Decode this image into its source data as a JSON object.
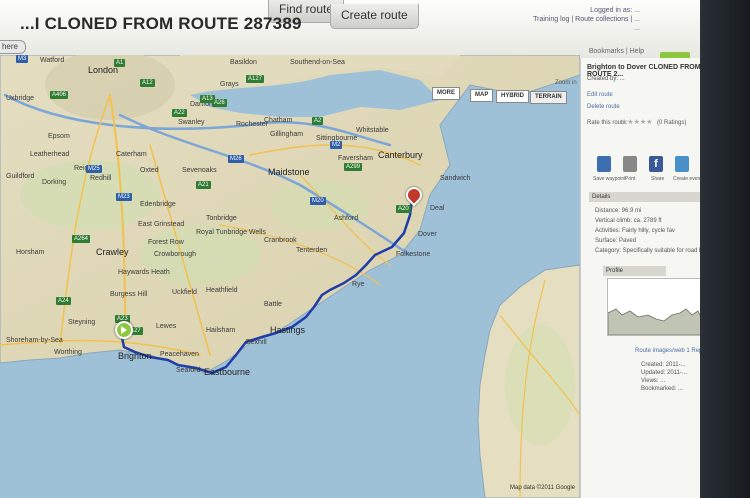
{
  "tabs": {
    "find_route": "Find route",
    "create_route": "Create route"
  },
  "route_title": "...I CLONED FROM ROUTE 287389",
  "here_button": "here",
  "map": {
    "controls": [
      "MORE",
      "MAP",
      "HYBRID",
      "TERRAIN"
    ],
    "zoom_link": "Zoom in",
    "footer": "Map data ©2011 Google",
    "places_big": [
      "London",
      "Crawley",
      "Brighton",
      "Eastbourne",
      "Hastings",
      "Canterbury",
      "Maidstone"
    ],
    "places": [
      "Uxbridge",
      "Watford",
      "Epsom",
      "Leatherhead",
      "Guildford",
      "Dorking",
      "Horsham",
      "Haywards Heath",
      "Burgess Hill",
      "Worthing",
      "Shoreham-by-Sea",
      "Lewes",
      "Uckfield",
      "Hailsham",
      "Seaford",
      "Peacehaven",
      "Newhaven",
      "Tonbridge",
      "Royal Tunbridge Wells",
      "Crowborough",
      "Forest Row",
      "East Grinstead",
      "Sevenoaks",
      "Chatham",
      "Gillingham",
      "Sittingbourne",
      "Faversham",
      "Whitstable",
      "Ashford",
      "Tenterden",
      "Folkestone",
      "Dover",
      "Deal",
      "Rye",
      "Bexhill",
      "Battle",
      "Heathfield",
      "Cranbrook",
      "Southend-on-Sea",
      "Basildon",
      "Grays",
      "Dartford",
      "Swanley",
      "Rochester",
      "Edenbridge",
      "Oxted",
      "Redhill",
      "Reigate",
      "Caterham",
      "Steyning",
      "Sandwich"
    ],
    "roads_green": [
      "A12",
      "A13",
      "A127",
      "A2",
      "A21",
      "A299",
      "A20",
      "A26",
      "A22",
      "A23",
      "A24",
      "A27",
      "A264",
      "A1",
      "A406"
    ],
    "roads_blue": [
      "M25",
      "M26",
      "M20",
      "M2",
      "M23",
      "M3"
    ]
  },
  "sidebar": {
    "title": "Brighton to Dover CLONED FROM ROUTE 2...",
    "created_by": "Created by: ...",
    "edit_route": "Edit route",
    "delete_route": "Delete route",
    "rate_this_route": "Rate this route:",
    "ratings": "(0 Ratings)",
    "share": [
      "Save waypoint",
      "Print",
      "Share",
      "Create event"
    ],
    "details_header": "Details",
    "details": [
      "Distance: 96.9 mi",
      "Vertical climb: ca. 2789 ft",
      "Activities: Fairly hilly, cycle fav",
      "Surface: Paved",
      "Category: Specifically suitable for road bike"
    ],
    "elevation_header": "Profile",
    "more_link": "Route images/web 1 Report",
    "footer_lines": [
      "Created: 2011-...",
      "Updated: 2011-...",
      "Views: ...",
      "Bookmarked: ..."
    ]
  },
  "header": {
    "links": [
      "Logged in as: ...",
      "Training log | Route collections | ...",
      "..."
    ],
    "bottom_links": "Bookmarks  |  Help"
  },
  "colors": {
    "accent_green": "#8dc63f",
    "route_blue": "#1f3ea8",
    "sea": "#9fc1d8",
    "land": "#e9e2c4"
  }
}
